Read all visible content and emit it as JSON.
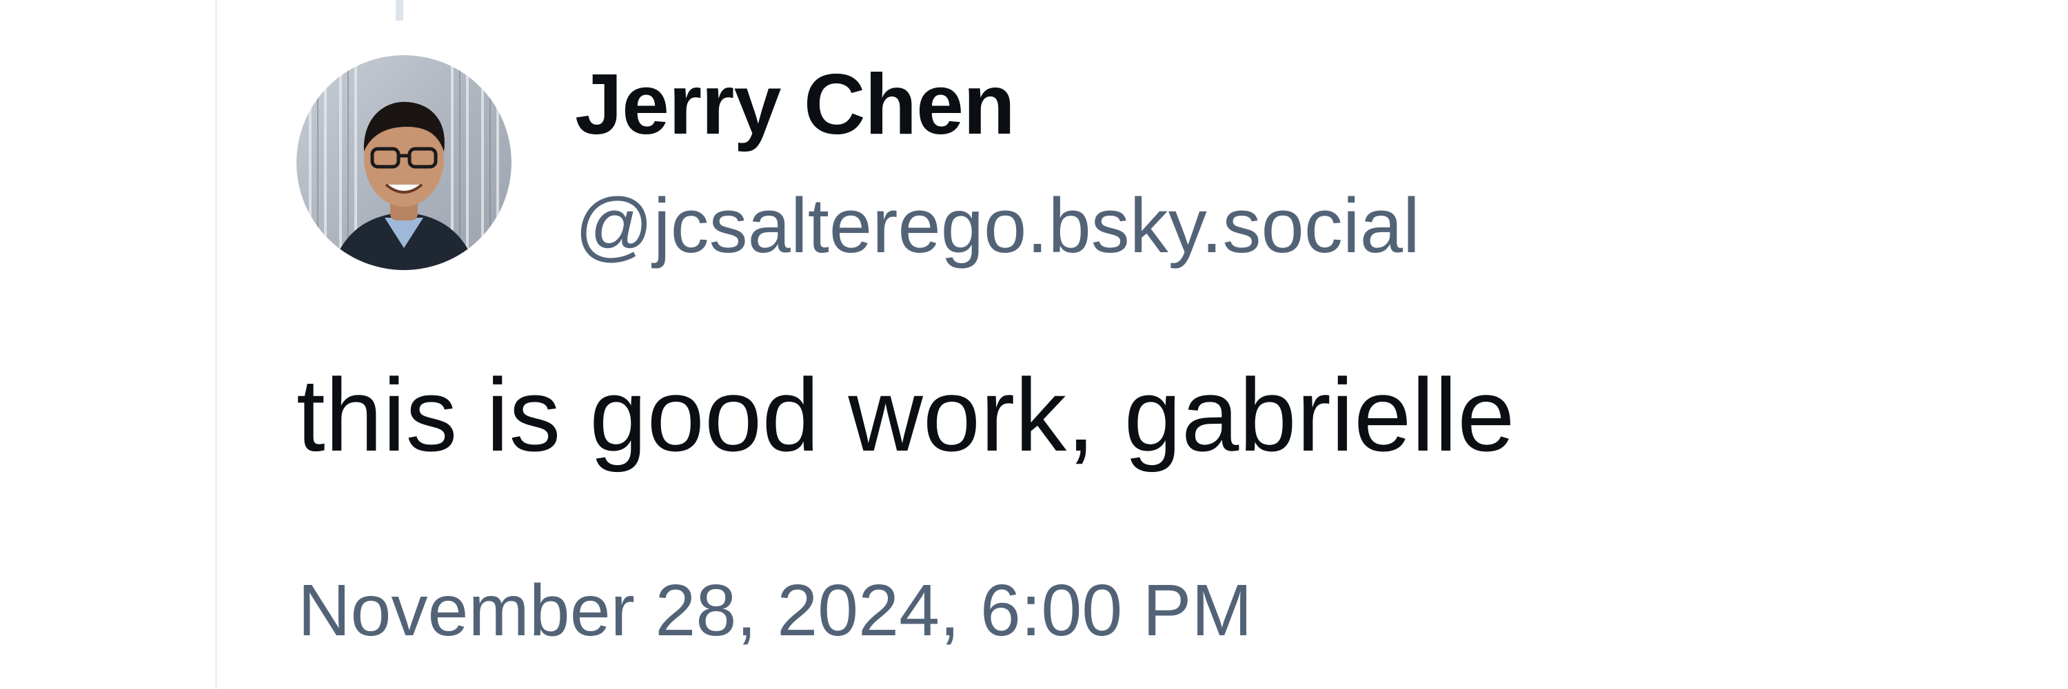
{
  "post": {
    "author": {
      "name": "Jerry Chen",
      "handle": "@jcsalterego.bsky.social",
      "avatar_icon": "user-avatar-photo"
    },
    "text": "this is good work, gabrielle",
    "timestamp": "November 28, 2024, 6:00 PM"
  },
  "colors": {
    "primary_text": "#0b0f14",
    "secondary_text": "#536377",
    "thread_line": "#dde3ea",
    "background": "#ffffff"
  }
}
